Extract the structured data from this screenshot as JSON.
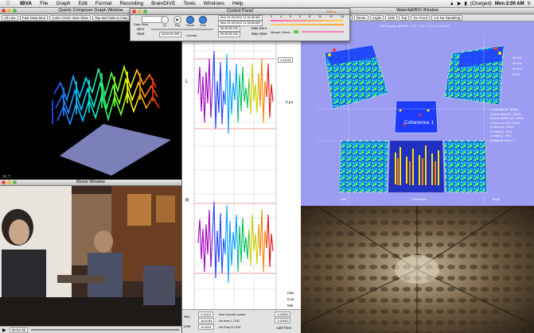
{
  "menubar": {
    "app": "IBVA",
    "items": [
      "File",
      "Graph",
      "Edit",
      "Format",
      "Recording",
      "BrainDIVE",
      "Tools",
      "Windows",
      "Help"
    ],
    "battery": "(Charged)",
    "clock": "Mon 2:00 AM"
  },
  "quartz": {
    "title": "Quartz Composer Graph Window",
    "buttons": [
      "All Line",
      "Fast Data Mon",
      "Color Circle View Slow",
      "Top and Side to map"
    ],
    "corner": "H..T"
  },
  "movie": {
    "title": "Movie Window",
    "time": "00:04:35"
  },
  "control": {
    "title": "Control Panel",
    "button_labels": [
      "Go",
      "Play",
      "Pause",
      "Goto"
    ],
    "labels": {
      "zero": "Zero",
      "start": "Start",
      "current": "Current",
      "max_zero": "Max-Zero",
      "max_start": "Max-Start",
      "range_left": "Date Start",
      "mouse_check": "Mouse Check"
    },
    "timestamps": [
      "Mon 01.03.2012 11:31:36 AM",
      "Mon 01.03.2012 11:30:58 AM",
      "00:32:59.191",
      "00:32:59.191"
    ],
    "current_time": "00:00:00.000",
    "battery_label": "Battery",
    "scale": [
      "3",
      "4",
      "5",
      "6",
      "8",
      "10",
      "12",
      "16"
    ]
  },
  "wave": {
    "channel_labels": [
      "L",
      "R"
    ],
    "side_values": [
      "1.11111",
      "0 μV"
    ],
    "bottom_labels": [
      "max",
      "Con",
      "Min"
    ],
    "footer": {
      "sec": "Sec",
      "line": "Line",
      "cursor_label": "Sec Current cursor",
      "fields": [
        "1.11111",
        "16.6754",
        "11.8411"
      ],
      "field_labels": [
        "Sec Current cursor",
        "Hz max L CH2",
        "Hz Freq R CH2"
      ],
      "add_time": "Add Time",
      "extra": [
        "1.00000",
        "1.00000"
      ]
    }
  },
  "waterfall": {
    "title": "Waterfall/BIS Window",
    "controls": [
      "Reset",
      "Angle",
      "Side",
      "Top",
      "Go Front"
    ],
    "toolbar_fields": [
      "00 1m 01.344",
      "0 05 1.469",
      "2.0 No Speaking"
    ],
    "center_label": "Coherence 1",
    "bottom_tabs": [
      "Left",
      "Coherence",
      "Right"
    ],
    "top_label": "EEG power (uV/Hz) 1.2 0.7 1.5 7.0 14 3.1 8.5 4.7",
    "legend": [
      "0.Gamma (37..40Hz)",
      "0.Beta High (27..30Hz)",
      "0.Beta Middle (15..18Hz)",
      "0.Beta Low (13..15Hz)",
      "0.Alpha (8..13Hz)",
      "0.Theta (4..8Hz)",
      "0.Delta (1..4Hz)",
      "0.Slow (0..1Hz)"
    ],
    "axis_right": [
      "30.0Hz",
      "20.0Hz",
      "10.0Hz",
      "5.0Hz"
    ]
  }
}
